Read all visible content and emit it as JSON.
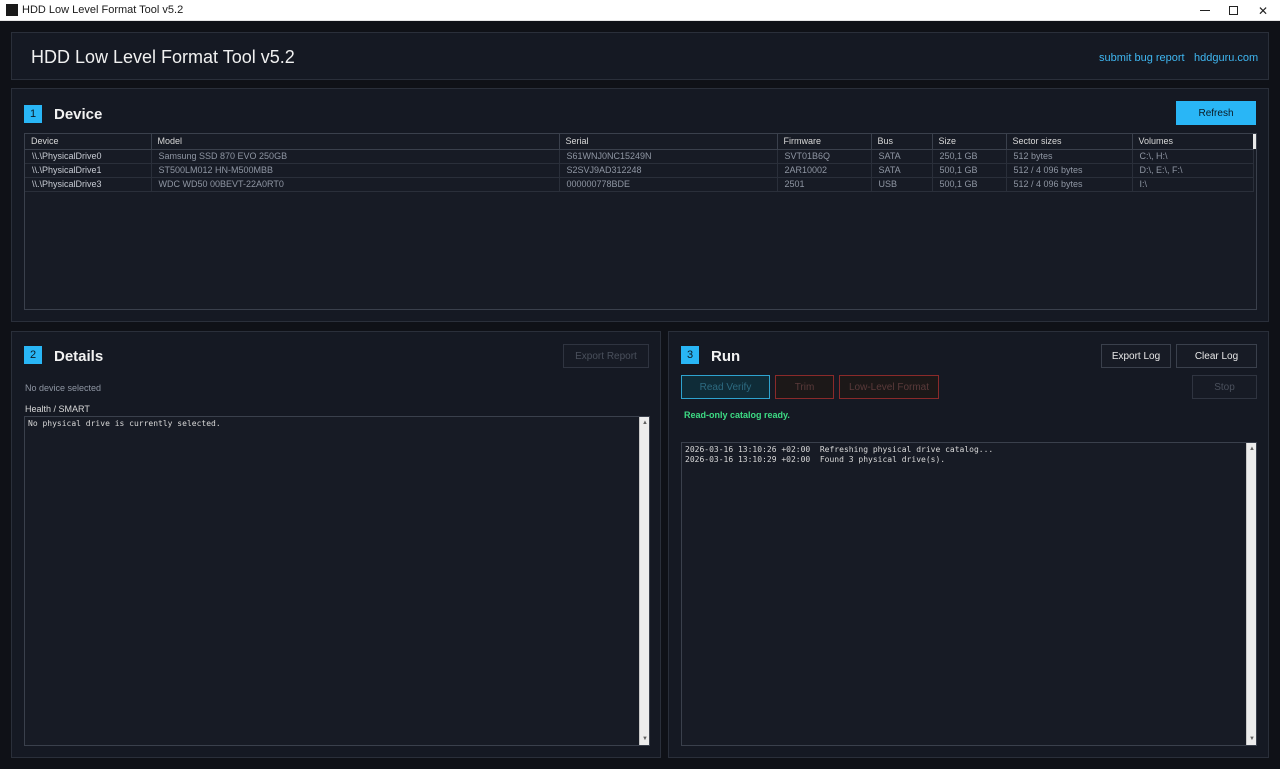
{
  "window": {
    "title": "HDD Low Level Format Tool v5.2",
    "minimize_glyph": "minimize-icon",
    "maximize_glyph": "maximize-icon",
    "close_glyph": "✕"
  },
  "header": {
    "title": "HDD Low Level Format Tool v5.2",
    "links": [
      "submit bug report",
      "hddguru.com"
    ]
  },
  "device": {
    "number": "1",
    "title": "Device",
    "refresh_label": "Refresh",
    "columns": [
      "Device",
      "Model",
      "Serial",
      "Firmware",
      "Bus",
      "Size",
      "Sector sizes",
      "Volumes"
    ],
    "rows": [
      [
        "\\\\.\\PhysicalDrive0",
        "Samsung SSD 870 EVO 250GB",
        "S61WNJ0NC15249N",
        "SVT01B6Q",
        "SATA",
        "250,1 GB",
        "512 bytes",
        "C:\\, H:\\"
      ],
      [
        "\\\\.\\PhysicalDrive1",
        "ST500LM012 HN-M500MBB",
        "S2SVJ9AD312248",
        "2AR10002",
        "SATA",
        "500,1 GB",
        "512 / 4 096 bytes",
        "D:\\, E:\\, F:\\"
      ],
      [
        "\\\\.\\PhysicalDrive3",
        "WDC WD50 00BEVT-22A0RT0",
        "000000778BDE",
        "2501",
        "USB",
        "500,1 GB",
        "512 / 4 096 bytes",
        "I:\\"
      ]
    ]
  },
  "details": {
    "number": "2",
    "title": "Details",
    "export_label": "Export Report",
    "no_device": "No device selected",
    "health_label": "Health / SMART",
    "health_text": "No physical drive is currently selected."
  },
  "run": {
    "number": "3",
    "title": "Run",
    "export_log_label": "Export Log",
    "clear_log_label": "Clear Log",
    "read_verify_label": "Read Verify",
    "trim_label": "Trim",
    "llf_label": "Low-Level Format",
    "stop_label": "Stop",
    "status": "Read-only catalog ready.",
    "log": [
      "2026-03-16 13:10:26 +02:00  Refreshing physical drive catalog...",
      "2026-03-16 13:10:29 +02:00  Found 3 physical drive(s)."
    ]
  },
  "colors": {
    "accent": "#29b6f6",
    "background": "#0f1117",
    "panel": "#151923",
    "success": "#3ddc84",
    "danger": "#8a2a2a"
  }
}
